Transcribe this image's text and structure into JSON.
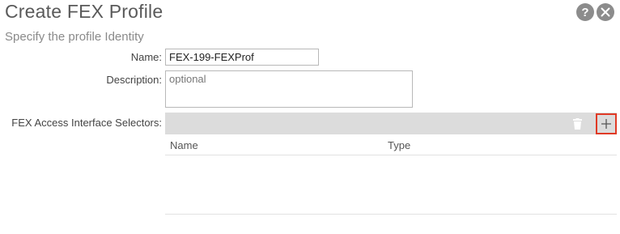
{
  "header": {
    "title": "Create FEX Profile",
    "help_icon": "help-icon",
    "close_icon": "close-icon"
  },
  "subtitle": "Specify the profile Identity",
  "form": {
    "name_label": "Name:",
    "name_value": "FEX-199-FEXProf",
    "description_label": "Description:",
    "description_placeholder": "optional",
    "selectors_label": "FEX Access Interface Selectors:"
  },
  "selectors_table": {
    "columns": [
      "Name",
      "Type"
    ],
    "rows": [],
    "delete_icon": "trash-icon",
    "add_icon": "plus-icon"
  },
  "colors": {
    "highlight": "#e03a26",
    "toolbar": "#dcdcdc",
    "icon_gray": "#8c8c8c"
  }
}
